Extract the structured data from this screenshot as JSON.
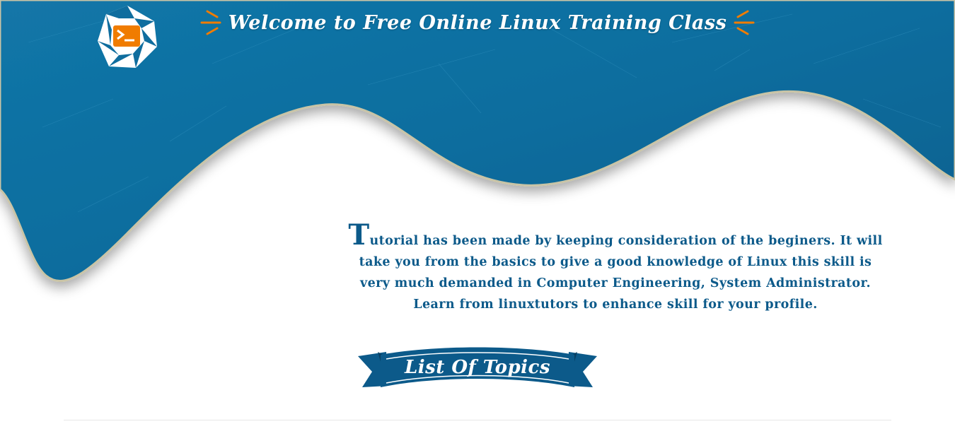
{
  "header": {
    "title": "Welcome to Free Online Linux Training Class",
    "logo_icon": "terminal-icon",
    "accent_color": "#f07c00",
    "primary_color": "#0c5a8a"
  },
  "intro": {
    "dropcap": "T",
    "text": "utorial has been made by keeping consideration of the beginers. It will take you from the basics to give a good knowledge of Linux this skill is very much demanded in Computer Engineering, System Administrator. Learn from linuxtutors to enhance skill for your profile."
  },
  "topics_banner": {
    "label": "List Of Topics"
  }
}
